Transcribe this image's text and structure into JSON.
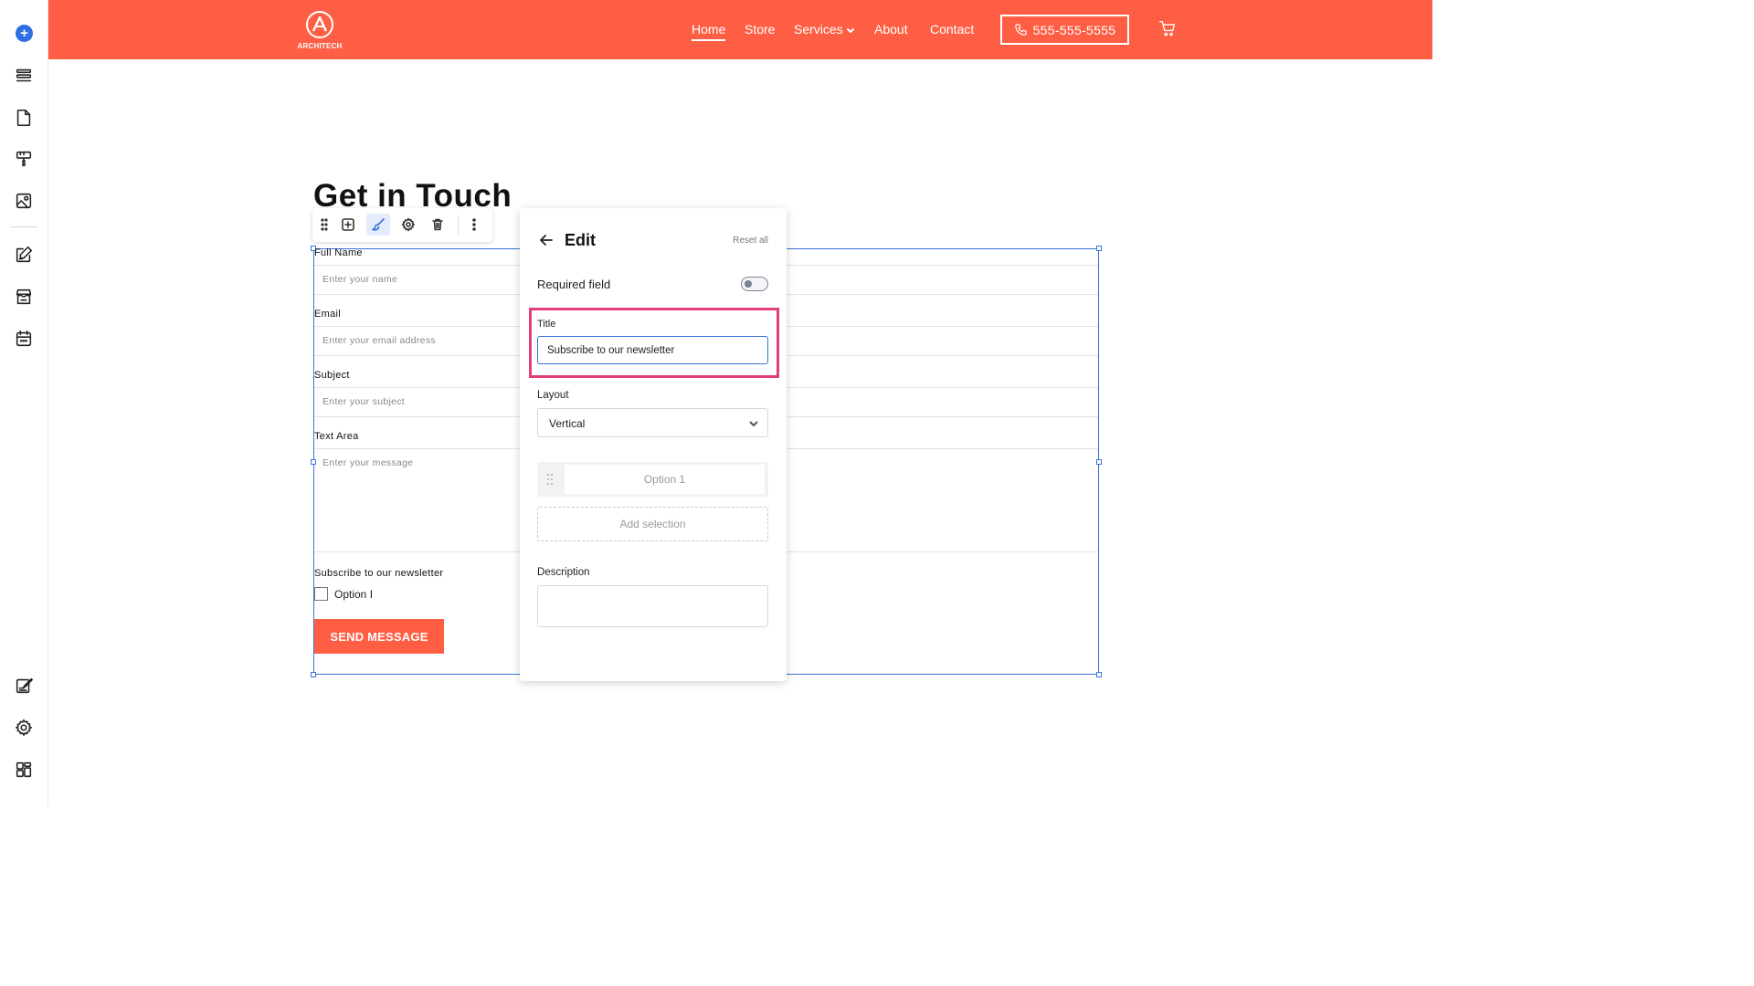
{
  "site": {
    "logo_text": "ARCHITECH",
    "nav": {
      "home": "Home",
      "store": "Store",
      "services": "Services",
      "about": "About",
      "contact": "Contact"
    },
    "phone": "555-555-5555"
  },
  "page": {
    "title": "Get in Touch"
  },
  "form": {
    "full_name_label": "Full Name",
    "full_name_placeholder": "Enter your name",
    "email_label": "Email",
    "email_placeholder": "Enter your email address",
    "subject_label": "Subject",
    "subject_placeholder": "Enter your subject",
    "textarea_label": "Text Area",
    "textarea_placeholder": "Enter your message",
    "newsletter_label": "Subscribe to our newsletter",
    "option_label": "Option I",
    "submit_label": "SEND MESSAGE"
  },
  "edit_panel": {
    "title": "Edit",
    "reset_all": "Reset all",
    "required_label": "Required field",
    "required_on": false,
    "title_field_label": "Title",
    "title_field_value": "Subscribe to our newsletter",
    "layout_label": "Layout",
    "layout_value": "Vertical",
    "option_1": "Option 1",
    "add_selection": "Add selection",
    "description_label": "Description",
    "description_value": ""
  },
  "colors": {
    "brand": "#fe5f44",
    "selection": "#3b73d9",
    "highlight": "#e23d7c",
    "rail_add": "#2f6fe4"
  }
}
